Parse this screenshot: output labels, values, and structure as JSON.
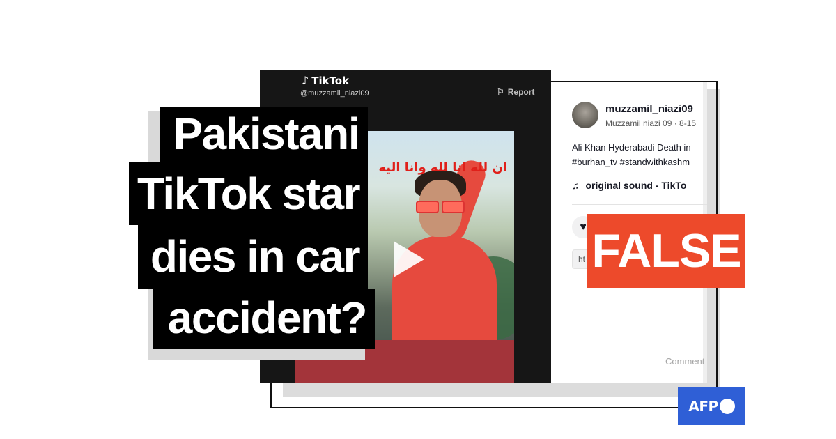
{
  "headline": {
    "lines": [
      "Pakistani",
      "TikTok star",
      "dies in car",
      "accident?"
    ]
  },
  "verdict": {
    "label": "FALSE",
    "color": "#ed4a2b"
  },
  "brand": {
    "logo_text": "AFP",
    "color": "#2f5fd6"
  },
  "tiktok": {
    "app_name": "TikTok",
    "handle": "@muzzamil_niazi09",
    "report_label": "Report",
    "video_caption": "ان لله انا لله وانا اليه"
  },
  "post": {
    "username": "muzzamil_niazi09",
    "meta": "Muzzamil niazi 09 · 8-15",
    "description_line1": "Ali Khan Hyderabadi Death in",
    "description_line2": "#burhan_tv #standwithkashm",
    "sound_label": "original sound - TikTo",
    "link_text": "ht",
    "comment_placeholder": "Comment"
  },
  "icons": {
    "tiktok": "tiktok-note-icon",
    "report": "flag-icon",
    "music": "music-note-icon",
    "like": "heart-icon",
    "play": "play-icon"
  }
}
